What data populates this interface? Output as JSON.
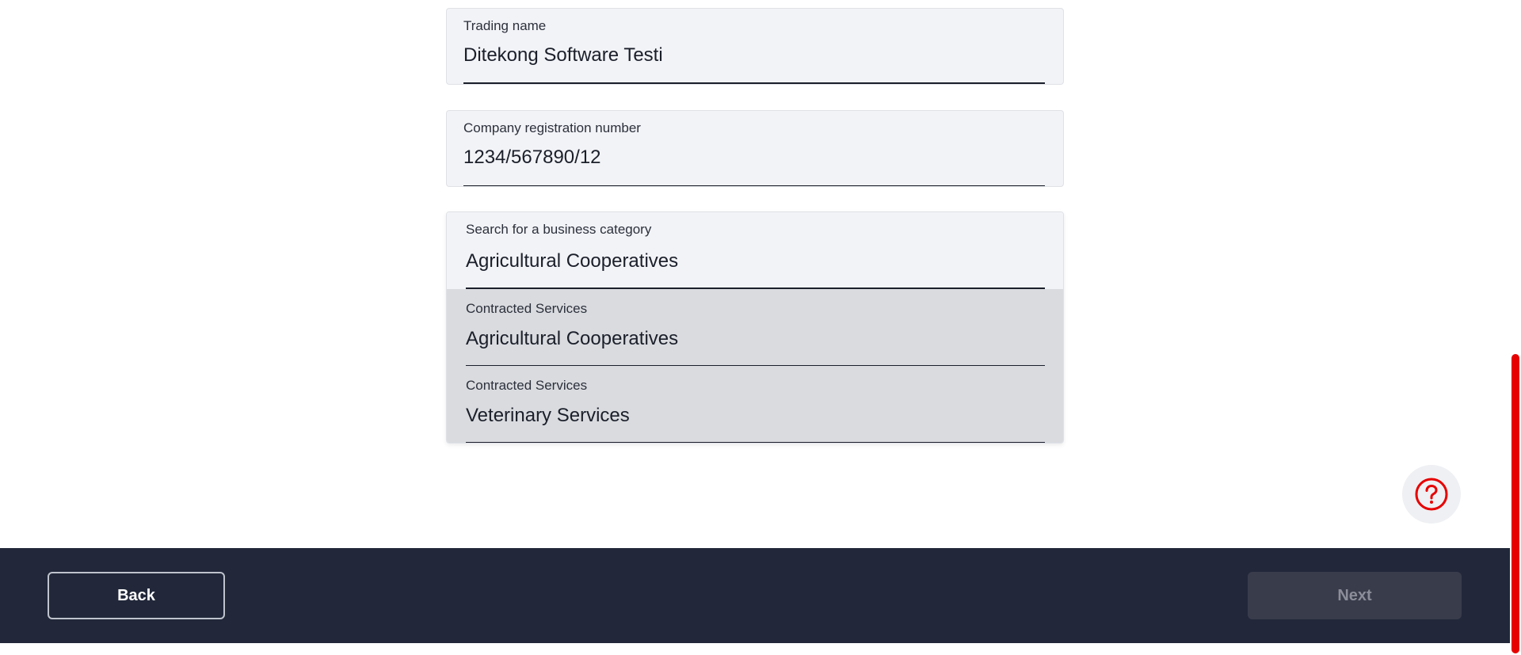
{
  "form": {
    "trading_name": {
      "label": "Trading name",
      "value": "Ditekong Software Testi"
    },
    "registration": {
      "label": "Company registration number",
      "value": "1234/567890/12"
    },
    "category_search": {
      "label": "Search for a business category",
      "value": "Agricultural Cooperatives"
    },
    "category_options": [
      {
        "group": "Contracted Services",
        "name": "Agricultural Cooperatives"
      },
      {
        "group": "Contracted Services",
        "name": "Veterinary Services"
      }
    ]
  },
  "help": {
    "icon": "question-circle-icon",
    "color": "#e60000"
  },
  "footer": {
    "back_label": "Back",
    "next_label": "Next",
    "background": "#22283a"
  },
  "colors": {
    "accent": "#e60000",
    "field_bg": "#f2f3f7",
    "option_bg": "#d9dbdf"
  }
}
